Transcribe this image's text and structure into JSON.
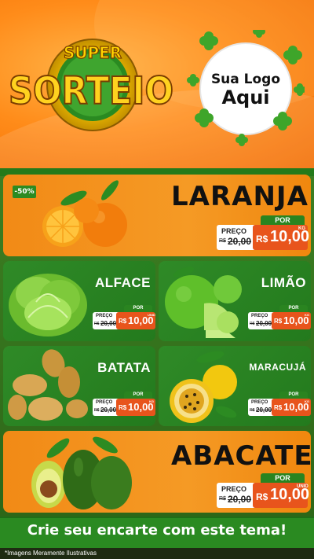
{
  "header": {
    "title_super": "SUPER",
    "title_main": "SORTEIO",
    "logo_line1": "Sua Logo",
    "logo_line2": "Aqui"
  },
  "colors": {
    "orange": "#f28a16",
    "green": "#2a8420",
    "price_red": "#e8541c",
    "clover": "#3ea52a"
  },
  "products": [
    {
      "name": "LARANJA",
      "discount": "-50%",
      "por": "POR",
      "preco_label": "PREÇO",
      "old_prefix": "R$",
      "old_price": "20,00",
      "currency": "R$",
      "price": "10,00",
      "unit": "KG"
    },
    {
      "name": "ALFACE",
      "por": "POR",
      "preco_label": "PREÇO",
      "old_prefix": "R$",
      "old_price": "20,00",
      "currency": "R$",
      "price": "10,00",
      "unit": "UNID"
    },
    {
      "name": "LIMÃO",
      "por": "POR",
      "preco_label": "PREÇO",
      "old_prefix": "R$",
      "old_price": "20,00",
      "currency": "R$",
      "price": "10,00",
      "unit": "KG"
    },
    {
      "name": "BATATA",
      "por": "POR",
      "preco_label": "PREÇO",
      "old_prefix": "R$",
      "old_price": "20,00",
      "currency": "R$",
      "price": "10,00",
      "unit": "KG"
    },
    {
      "name": "MARACUJÁ",
      "por": "POR",
      "preco_label": "PREÇO",
      "old_prefix": "R$",
      "old_price": "20,00",
      "currency": "R$",
      "price": "10,00",
      "unit": "KG"
    },
    {
      "name": "ABACATE",
      "por": "POR",
      "preco_label": "PREÇO",
      "old_prefix": "R$",
      "old_price": "20,00",
      "currency": "R$",
      "price": "10,00",
      "unit": "UNID"
    }
  ],
  "footer": {
    "cta": "Crie seu encarte com este tema!",
    "disclaimer": "*Imagens Meramente Ilustrativas"
  }
}
